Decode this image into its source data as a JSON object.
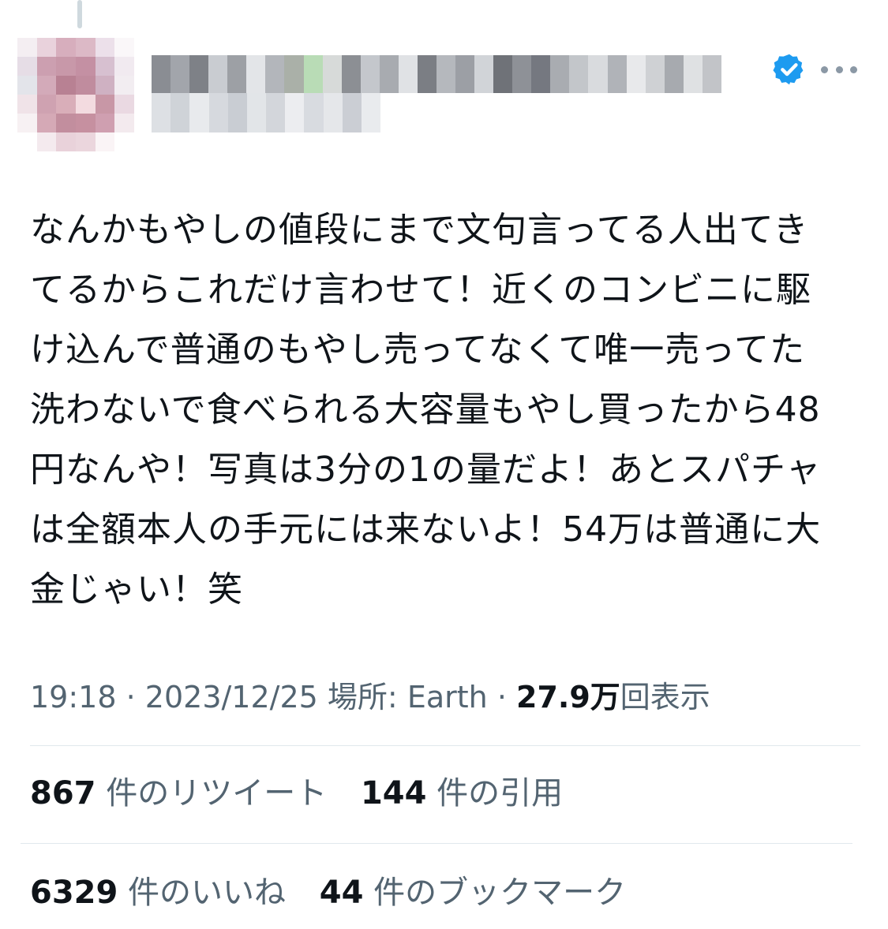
{
  "author": {
    "display_name": "",
    "handle": "",
    "verified": true,
    "avatar_icon": "blurred-avatar"
  },
  "icons": {
    "verified": "verified-badge-icon",
    "more": "more-options-icon"
  },
  "colors": {
    "verified_blue": "#1d9bf0",
    "secondary_text": "#536471",
    "primary_text": "#0f1419",
    "divider": "#e1e8ed"
  },
  "tweet": {
    "text": "なんかもやしの値段にまで文句言ってる人出てきてるからこれだけ言わせて！近くのコンビニに駆け込んで普通のもやし売ってなくて唯一売ってた洗わないで食べられる大容量もやし買ったから48円なんや！写真は3分の1の量だよ！あとスパチャは全額本人の手元には来ないよ！54万は普通に大金じゃい！笑"
  },
  "meta": {
    "time": "19:18",
    "separator": "·",
    "date": "2023/12/25",
    "location_label": "場所:",
    "location_value": "Earth",
    "views_count": "27.9万",
    "views_label": "回表示"
  },
  "stats": {
    "retweets_count": "867",
    "retweets_label": "件のリツイート",
    "quotes_count": "144",
    "quotes_label": "件の引用",
    "likes_count": "6329",
    "likes_label": "件のいいね",
    "bookmarks_count": "44",
    "bookmarks_label": "件のブックマーク"
  }
}
